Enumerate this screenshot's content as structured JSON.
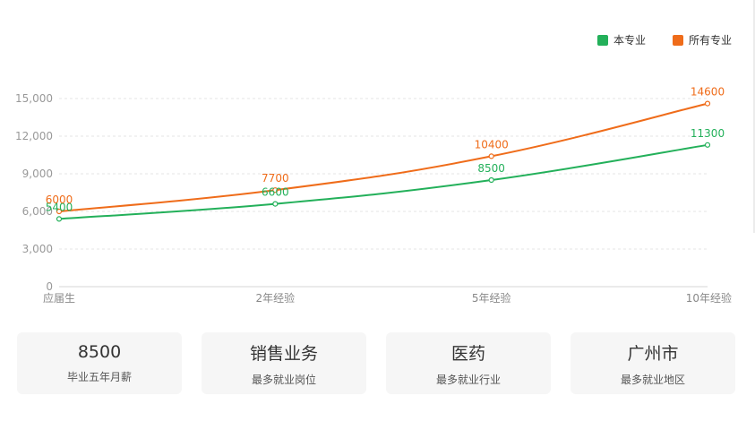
{
  "chart_data": {
    "type": "line",
    "categories": [
      "应届生",
      "2年经验",
      "5年经验",
      "10年经验"
    ],
    "series": [
      {
        "name": "本专业",
        "color": "#23b05a",
        "values": [
          5400,
          6600,
          8500,
          11300
        ]
      },
      {
        "name": "所有专业",
        "color": "#ef6c1a",
        "values": [
          6000,
          7700,
          10400,
          14600
        ]
      }
    ],
    "y_ticks": [
      "0",
      "3,000",
      "6,000",
      "9,000",
      "12,000",
      "15,000"
    ],
    "ylim": [
      0,
      15000
    ],
    "grid": "horizontal-dashed",
    "legend_position": "top-right",
    "data_labels": true
  },
  "stats": [
    {
      "value": "8500",
      "label": "毕业五年月薪"
    },
    {
      "value": "销售业务",
      "label": "最多就业岗位"
    },
    {
      "value": "医药",
      "label": "最多就业行业"
    },
    {
      "value": "广州市",
      "label": "最多就业地区"
    }
  ]
}
